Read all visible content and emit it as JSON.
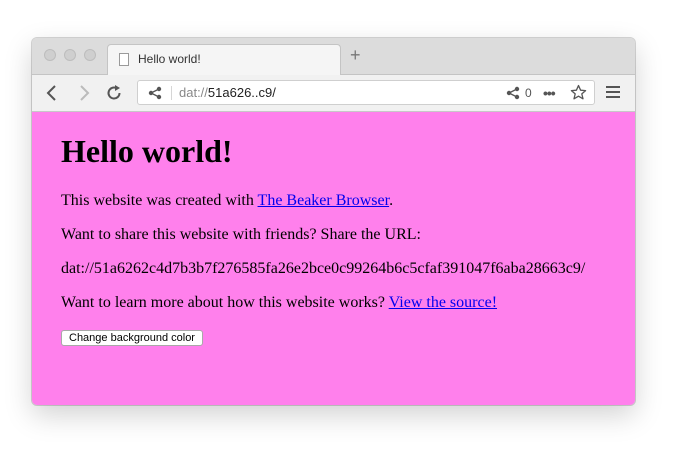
{
  "tab": {
    "title": "Hello world!",
    "new_tab_label": "+"
  },
  "urlbar": {
    "scheme": "dat://",
    "address": "51a626..c9/",
    "peer_count": "0"
  },
  "page": {
    "heading": "Hello world!",
    "created_prefix": "This website was created with ",
    "created_link": "The Beaker Browser",
    "created_suffix": ".",
    "share_prompt": "Want to share this website with friends? Share the URL:",
    "full_url": "dat://51a6262c4d7b3b7f276585fa26e2bce0c99264b6c5cfaf391047f6aba28663c9/",
    "learn_prefix": "Want to learn more about how this website works? ",
    "learn_link": "View the source!",
    "button_label": "Change background color"
  },
  "colors": {
    "page_background": "#ff80ec",
    "link": "#0000ee"
  }
}
